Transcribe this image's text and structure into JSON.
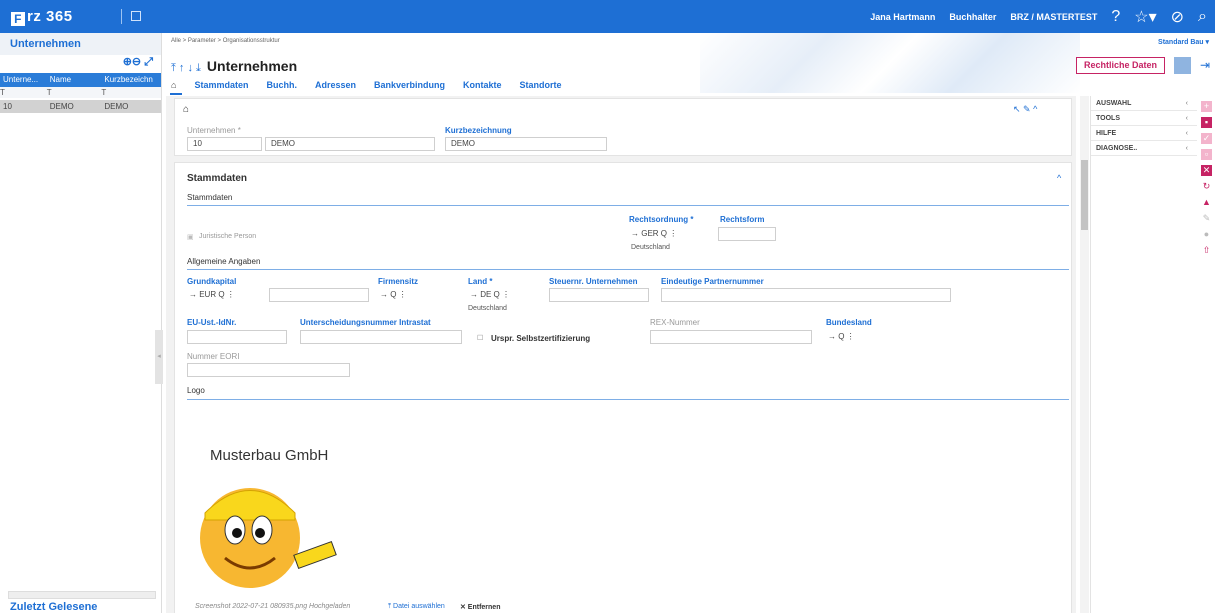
{
  "app": {
    "logo_box": "F",
    "logo_text": "rz 365",
    "user": "Jana Hartmann",
    "role": "Buchhalter",
    "tenant": "BRZ / MASTERTEST",
    "std_label": "Standard Bau ▾"
  },
  "leftpanel": {
    "title": "Unternehmen",
    "tools": "⊕⊖ ⤢",
    "columns": [
      "Unterne...",
      "Name",
      "Kurzbezeichn"
    ],
    "filter": [
      "T",
      "T",
      "T"
    ],
    "rows": [
      [
        "10",
        "DEMO",
        "DEMO"
      ]
    ],
    "bottom": "Zuletzt Gelesene"
  },
  "header": {
    "breadcrumb": "Alle  >  Parameter  >  Organisationsstruktur",
    "arrows": "⤒ ↑ ↓ ⤓",
    "title": "Unternehmen",
    "tabs": [
      "⌂",
      "Stammdaten",
      "Buchh.",
      "Adressen",
      "Bankverbindung",
      "Kontakte",
      "Standorte"
    ],
    "legal_button": "Rechtliche Daten"
  },
  "card1": {
    "home": "⌂",
    "tools": "↖ ✎ ^",
    "lbl_unternehmen": "Unternehmen *",
    "lbl_kurz": "Kurzbezeichnung",
    "val_nr": "10",
    "val_name": "DEMO",
    "val_kurz": "DEMO"
  },
  "card2": {
    "title": "Stammdaten",
    "collapse": "^",
    "sec_stamm": "Stammdaten",
    "juristische": "Juristische Person",
    "lbl_rechtsordnung": "Rechtsordnung *",
    "val_rechtsordnung": "→  GER    Q ⋮",
    "sub_rechtsordnung": "Deutschland",
    "lbl_rechtsform": "Rechtsform",
    "sec_allgemein": "Allgemeine Angaben",
    "lbl_grundkapital": "Grundkapital",
    "val_grundkapital": "→  EUR   Q ⋮",
    "lbl_firmensitz": "Firmensitz",
    "val_firmensitz": "→                  Q ⋮",
    "lbl_land": "Land *",
    "val_land": "→  DE    Q ⋮",
    "sub_land": "Deutschland",
    "lbl_steuer": "Steuernr. Unternehmen",
    "lbl_partner": "Eindeutige Partnernummer",
    "lbl_ustid": "EU-Ust.-IdNr.",
    "lbl_intrastat": "Unterscheidungsnummer Intrastat",
    "chk_selbst": "Urspr. Selbstzertifizierung",
    "lbl_rex": "REX-Nummer",
    "lbl_bundesland": "Bundesland",
    "val_bundesland": "→                        Q ⋮",
    "lbl_eori": "Nummer EORI",
    "sec_logo": "Logo",
    "logo_company": "Musterbau GmbH",
    "uploaded": "Screenshot 2022-07-21 080935.png Hochgeladen",
    "choose_file": "⤒ Datei auswählen",
    "remove": "✕ Entfernen"
  },
  "rightpanel": {
    "items": [
      "AUSWAHL",
      "TOOLS",
      "HILFE",
      "DIAGNOSE.."
    ]
  },
  "colors": {
    "brand": "#1e6fd4",
    "accent": "#c62364"
  }
}
